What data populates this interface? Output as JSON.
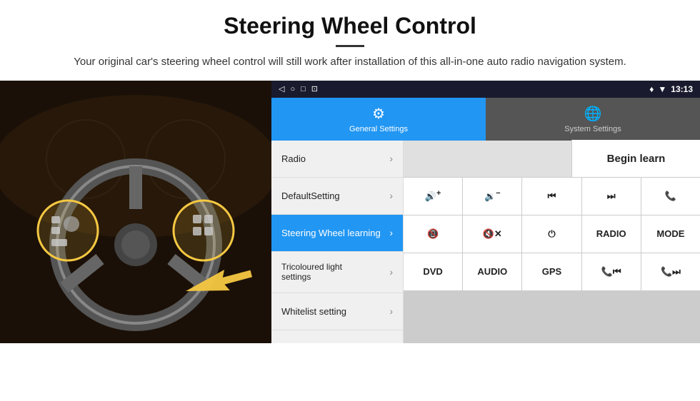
{
  "header": {
    "title": "Steering Wheel Control",
    "subtitle": "Your original car's steering wheel control will still work after installation of this all-in-one auto radio navigation system."
  },
  "status_bar": {
    "time": "13:13",
    "left_icons": [
      "◁",
      "○",
      "□",
      "⊡"
    ],
    "right_icons": [
      "♦",
      "▼"
    ]
  },
  "nav_tabs": [
    {
      "id": "general",
      "label": "General Settings",
      "icon": "⚙",
      "active": true
    },
    {
      "id": "system",
      "label": "System Settings",
      "icon": "⊕",
      "active": false
    }
  ],
  "menu_items": [
    {
      "id": "radio",
      "label": "Radio",
      "active": false
    },
    {
      "id": "default",
      "label": "DefaultSetting",
      "active": false
    },
    {
      "id": "steering",
      "label": "Steering Wheel learning",
      "active": true
    },
    {
      "id": "tricoloured",
      "label": "Tricoloured light settings",
      "active": false
    },
    {
      "id": "whitelist",
      "label": "Whitelist setting",
      "active": false
    }
  ],
  "begin_learn_label": "Begin learn",
  "button_grid": [
    {
      "id": "vol-up",
      "label": "🔊+",
      "type": "icon"
    },
    {
      "id": "vol-down",
      "label": "🔉-",
      "type": "icon"
    },
    {
      "id": "prev-track",
      "label": "⏮",
      "type": "icon"
    },
    {
      "id": "next-track",
      "label": "⏭",
      "type": "icon"
    },
    {
      "id": "phone",
      "label": "📞",
      "type": "icon"
    },
    {
      "id": "hang-up",
      "label": "📵",
      "type": "icon"
    },
    {
      "id": "mute",
      "label": "🔇×",
      "type": "icon"
    },
    {
      "id": "power",
      "label": "⏻",
      "type": "icon"
    },
    {
      "id": "radio-btn",
      "label": "RADIO",
      "type": "text"
    },
    {
      "id": "mode",
      "label": "MODE",
      "type": "text"
    },
    {
      "id": "dvd",
      "label": "DVD",
      "type": "text"
    },
    {
      "id": "audio",
      "label": "AUDIO",
      "type": "text"
    },
    {
      "id": "gps",
      "label": "GPS",
      "type": "text"
    },
    {
      "id": "tel-prev",
      "label": "📞⏮",
      "type": "icon"
    },
    {
      "id": "tel-next",
      "label": "📞⏭",
      "type": "icon"
    }
  ],
  "icons": {
    "back": "◁",
    "home": "○",
    "recent": "□",
    "screenshot": "⊡",
    "location": "♦",
    "signal": "▼",
    "gear": "⚙",
    "globe": "⊕",
    "chevron": "›",
    "arrow": "➤"
  },
  "colors": {
    "active_blue": "#2196F3",
    "status_bar_bg": "#1a1a2e",
    "menu_bg": "#f0f0f0",
    "panel_bg": "#e0e0e0",
    "white": "#ffffff",
    "text_dark": "#222222",
    "accent_yellow": "#f5c842"
  }
}
